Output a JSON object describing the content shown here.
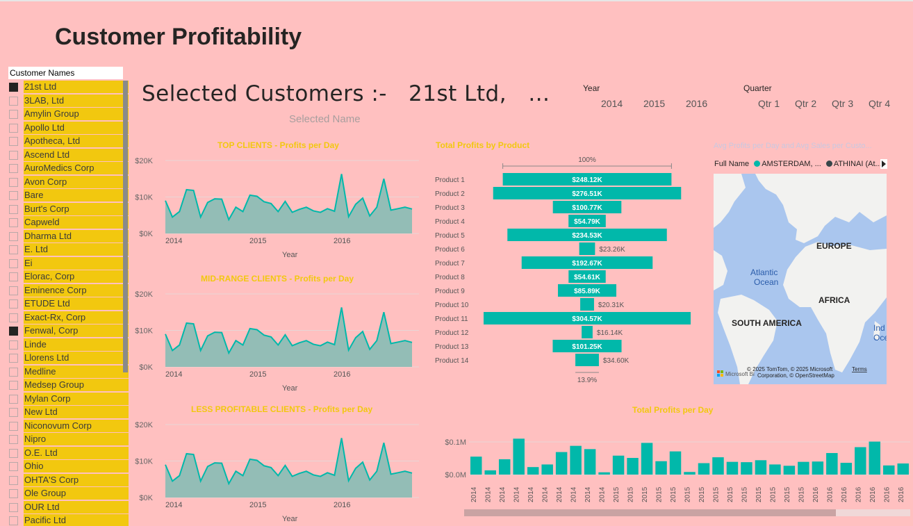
{
  "title": "Customer Profitability",
  "slicer": {
    "header": "Customer Names",
    "items": [
      {
        "label": "21st Ltd",
        "checked": true
      },
      {
        "label": "3LAB, Ltd",
        "checked": false
      },
      {
        "label": "Amylin Group",
        "checked": false
      },
      {
        "label": "Apollo Ltd",
        "checked": false
      },
      {
        "label": "Apotheca, Ltd",
        "checked": false
      },
      {
        "label": "Ascend Ltd",
        "checked": false
      },
      {
        "label": "AuroMedics Corp",
        "checked": false
      },
      {
        "label": "Avon Corp",
        "checked": false
      },
      {
        "label": "Bare",
        "checked": false
      },
      {
        "label": "Burt's Corp",
        "checked": false
      },
      {
        "label": "Capweld",
        "checked": false
      },
      {
        "label": "Dharma Ltd",
        "checked": false
      },
      {
        "label": "E. Ltd",
        "checked": false
      },
      {
        "label": "Ei",
        "checked": false
      },
      {
        "label": "Elorac, Corp",
        "checked": false
      },
      {
        "label": "Eminence Corp",
        "checked": false
      },
      {
        "label": "ETUDE Ltd",
        "checked": false
      },
      {
        "label": "Exact-Rx, Corp",
        "checked": false
      },
      {
        "label": "Fenwal, Corp",
        "checked": true
      },
      {
        "label": "Linde",
        "checked": false
      },
      {
        "label": "Llorens Ltd",
        "checked": false
      },
      {
        "label": "Medline",
        "checked": false
      },
      {
        "label": "Medsep Group",
        "checked": false
      },
      {
        "label": "Mylan Corp",
        "checked": false
      },
      {
        "label": "New Ltd",
        "checked": false
      },
      {
        "label": "Niconovum Corp",
        "checked": false
      },
      {
        "label": "Nipro",
        "checked": false
      },
      {
        "label": "O.E. Ltd",
        "checked": false
      },
      {
        "label": "Ohio",
        "checked": false
      },
      {
        "label": "OHTA'S Corp",
        "checked": false
      },
      {
        "label": "Ole Group",
        "checked": false
      },
      {
        "label": "OUR Ltd",
        "checked": false
      },
      {
        "label": "Pacific Ltd",
        "checked": false
      }
    ]
  },
  "selected": {
    "title": "Selected Customers :-   21st Ltd,   …",
    "subtitle": "Selected Name"
  },
  "filters": {
    "year_label": "Year",
    "years": [
      "2014",
      "2015",
      "2016"
    ],
    "quarter_label": "Quarter",
    "quarters": [
      "Qtr 1",
      "Qtr 2",
      "Qtr 3",
      "Qtr 4"
    ]
  },
  "colors": {
    "background": "#ffc0c0",
    "accent": "#01b8aa",
    "slicer_fill": "#f2c80f",
    "title_yellow": "#f2c80f",
    "area_fill": "#93bdb6"
  },
  "chart_data": [
    {
      "type": "area",
      "title": "TOP CLIENTS - Profits per Day",
      "xlabel": "Year",
      "x_ticks": [
        "2014",
        "2015",
        "2016"
      ],
      "y_ticks": [
        "$0K",
        "$10K",
        "$20K"
      ],
      "ylim": [
        0,
        20000
      ],
      "values": [
        9000,
        4500,
        6000,
        12000,
        11800,
        4500,
        8500,
        9500,
        9400,
        3800,
        7200,
        6000,
        10500,
        10200,
        8700,
        8200,
        6000,
        8800,
        5800,
        6600,
        7200,
        6200,
        5800,
        6800,
        6100,
        16300,
        4600,
        8000,
        9700,
        4800,
        7200,
        15000,
        6400,
        6800,
        7200,
        6700
      ]
    },
    {
      "type": "area",
      "title": "MID-RANGE CLIENTS - Profits per Day",
      "xlabel": "Year",
      "x_ticks": [
        "2014",
        "2015",
        "2016"
      ],
      "y_ticks": [
        "$0K",
        "$10K",
        "$20K"
      ],
      "ylim": [
        0,
        20000
      ],
      "values": [
        9000,
        4500,
        6000,
        12000,
        11800,
        4500,
        8500,
        9500,
        9400,
        3800,
        7200,
        6000,
        10500,
        10200,
        8700,
        8200,
        6000,
        8800,
        5800,
        6600,
        7200,
        6200,
        5800,
        6800,
        6100,
        16300,
        4600,
        8000,
        9700,
        4800,
        7200,
        15000,
        6400,
        6800,
        7200,
        6700
      ]
    },
    {
      "type": "area",
      "title": "LESS PROFITABLE CLIENTS - Profits per Day",
      "xlabel": "Year",
      "x_ticks": [
        "2014",
        "2015",
        "2016"
      ],
      "y_ticks": [
        "$0K",
        "$10K",
        "$20K"
      ],
      "ylim": [
        0,
        20000
      ],
      "values": [
        9000,
        4500,
        6000,
        12000,
        11800,
        4500,
        8500,
        9500,
        9400,
        3800,
        7200,
        6000,
        10500,
        10200,
        8700,
        8200,
        6000,
        8800,
        5800,
        6600,
        7200,
        6200,
        5800,
        6800,
        6100,
        16300,
        4600,
        8000,
        9700,
        4800,
        7200,
        15000,
        6400,
        6800,
        7200,
        6700
      ]
    },
    {
      "type": "bar",
      "title": "Total Profits by Product",
      "top_label": "100%",
      "bottom_label": "13.9%",
      "categories": [
        "Product 1",
        "Product 2",
        "Product 3",
        "Product 4",
        "Product 5",
        "Product 6",
        "Product 7",
        "Product 8",
        "Product 9",
        "Product 10",
        "Product 11",
        "Product 12",
        "Product 13",
        "Product 14"
      ],
      "values": [
        248120,
        276510,
        100770,
        54790,
        234530,
        23260,
        192670,
        54610,
        85890,
        20310,
        304570,
        16140,
        101250,
        34600
      ],
      "labels": [
        "$248.12K",
        "$276.51K",
        "$100.77K",
        "$54.79K",
        "$234.53K",
        "$23.26K",
        "$192.67K",
        "$54.61K",
        "$85.89K",
        "$20.31K",
        "$304.57K",
        "$16.14K",
        "$101.25K",
        "$34.60K"
      ]
    },
    {
      "type": "bar",
      "title": "Total Profits per Day",
      "y_ticks": [
        "$0.0M",
        "$0.1M"
      ],
      "ylim": [
        0,
        0.1
      ],
      "categories": [
        "2014",
        "2014",
        "2014",
        "2014",
        "2014",
        "2014",
        "2014",
        "2014",
        "2014",
        "2014",
        "2015",
        "2015",
        "2015",
        "2015",
        "2015",
        "2015",
        "2015",
        "2015",
        "2015",
        "2015",
        "2015",
        "2015",
        "2015",
        "2015",
        "2016",
        "2016",
        "2016",
        "2016",
        "2016",
        "2016",
        "2016"
      ],
      "values": [
        0.055,
        0.013,
        0.047,
        0.11,
        0.023,
        0.031,
        0.069,
        0.088,
        0.078,
        0.007,
        0.058,
        0.051,
        0.097,
        0.041,
        0.071,
        0.008,
        0.035,
        0.053,
        0.039,
        0.038,
        0.044,
        0.031,
        0.027,
        0.039,
        0.04,
        0.066,
        0.036,
        0.084,
        0.101,
        0.028,
        0.034
      ]
    }
  ],
  "map": {
    "title": "Avg Profits per Day and Avg Sales per Custo...",
    "legend_label": "Full Name",
    "legend_items": [
      {
        "label": "AMSTERDAM, ...",
        "color": "#01b8aa"
      },
      {
        "label": "ATHINAI (At...",
        "color": "#374649"
      }
    ],
    "labels": {
      "europe": "EUROPE",
      "atlantic": "Atlantic",
      "ocean": "Ocean",
      "africa": "AFRICA",
      "south_america": "SOUTH AMERICA",
      "indian_1": "Ind",
      "indian_2": "Oce"
    },
    "attribution_1": "© 2025 TomTom, © 2025 Microsoft",
    "attribution_terms": "Terms",
    "attribution_2": "Corporation, © OpenStreetMap",
    "brand": "Microsoft Bi"
  }
}
